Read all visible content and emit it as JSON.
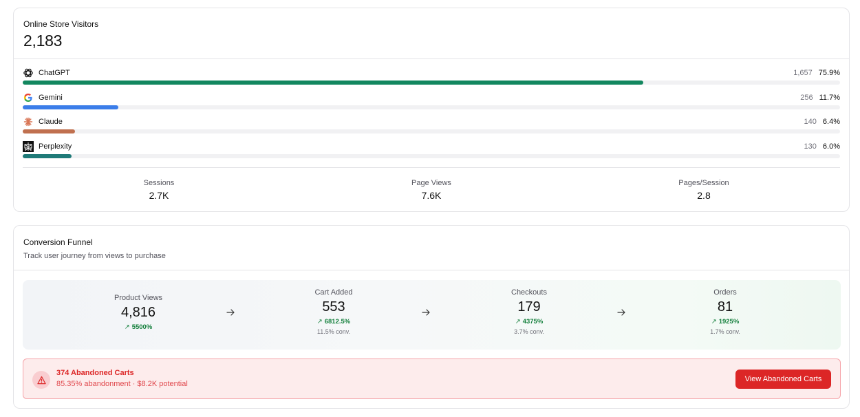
{
  "visitors": {
    "title": "Online Store Visitors",
    "total": "2,183",
    "sources": [
      {
        "name": "ChatGPT",
        "count": "1,657",
        "percent": "75.9%",
        "fraction": 0.759,
        "color": "#13875f",
        "icon": "chatgpt-icon"
      },
      {
        "name": "Gemini",
        "count": "256",
        "percent": "11.7%",
        "fraction": 0.117,
        "color": "#3b7de9",
        "icon": "gemini-icon"
      },
      {
        "name": "Claude",
        "count": "140",
        "percent": "6.4%",
        "fraction": 0.064,
        "color": "#c0704f",
        "icon": "claude-icon"
      },
      {
        "name": "Perplexity",
        "count": "130",
        "percent": "6.0%",
        "fraction": 0.06,
        "color": "#1f7a78",
        "icon": "perplexity-icon"
      }
    ],
    "metrics": [
      {
        "label": "Sessions",
        "value": "2.7K"
      },
      {
        "label": "Page Views",
        "value": "7.6K"
      },
      {
        "label": "Pages/Session",
        "value": "2.8"
      }
    ]
  },
  "funnel": {
    "title": "Conversion Funnel",
    "subtitle": "Track user journey from views to purchase",
    "stages": [
      {
        "label": "Product Views",
        "value": "4,816",
        "change": "5500%",
        "conv": ""
      },
      {
        "label": "Cart Added",
        "value": "553",
        "change": "6812.5%",
        "conv": "11.5% conv."
      },
      {
        "label": "Checkouts",
        "value": "179",
        "change": "4375%",
        "conv": "3.7% conv."
      },
      {
        "label": "Orders",
        "value": "81",
        "change": "1925%",
        "conv": "1.7% conv."
      }
    ],
    "change_color": "#15803d"
  },
  "alert": {
    "title": "374 Abandoned Carts",
    "subtitle": "85.35% abandonment · $8.2K potential",
    "button_label": "View Abandoned Carts",
    "icon": "warning-triangle-icon",
    "color": "#dc2626"
  }
}
